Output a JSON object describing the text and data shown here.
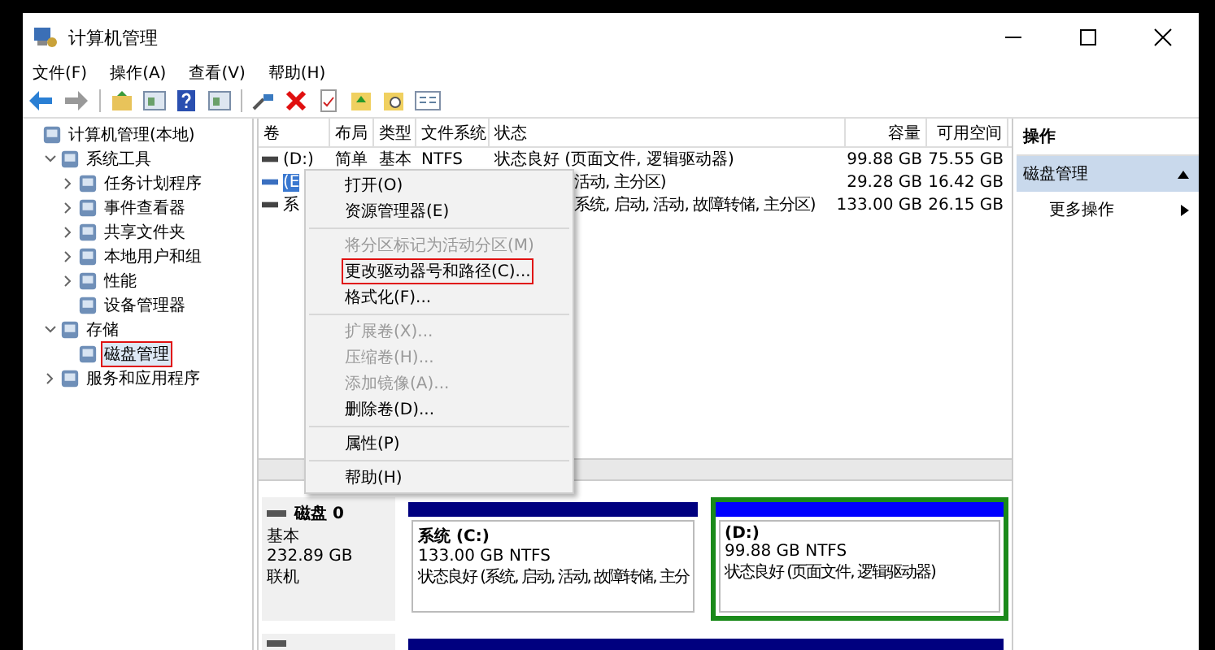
{
  "window": {
    "title": "计算机管理"
  },
  "menu": [
    "文件(F)",
    "操作(A)",
    "查看(V)",
    "帮助(H)"
  ],
  "tree": [
    {
      "label": "计算机管理(本地)",
      "expandable": false,
      "selected": false,
      "highlighted": false,
      "children": [
        {
          "label": "系统工具",
          "expandable": true,
          "expanded": true,
          "selected": false,
          "highlighted": false,
          "children": [
            {
              "label": "任务计划程序",
              "expandable": true,
              "expanded": false,
              "selected": false,
              "highlighted": false
            },
            {
              "label": "事件查看器",
              "expandable": true,
              "expanded": false,
              "selected": false,
              "highlighted": false
            },
            {
              "label": "共享文件夹",
              "expandable": true,
              "expanded": false,
              "selected": false,
              "highlighted": false
            },
            {
              "label": "本地用户和组",
              "expandable": true,
              "expanded": false,
              "selected": false,
              "highlighted": false
            },
            {
              "label": "性能",
              "expandable": true,
              "expanded": false,
              "selected": false,
              "highlighted": false
            },
            {
              "label": "设备管理器",
              "expandable": false,
              "expanded": false,
              "selected": false,
              "highlighted": false
            }
          ]
        },
        {
          "label": "存储",
          "expandable": true,
          "expanded": true,
          "selected": false,
          "highlighted": false,
          "children": [
            {
              "label": "磁盘管理",
              "expandable": false,
              "expanded": false,
              "selected": true,
              "highlighted": true
            }
          ]
        },
        {
          "label": "服务和应用程序",
          "expandable": true,
          "expanded": false,
          "selected": false,
          "highlighted": false
        }
      ]
    }
  ],
  "table": {
    "columns": [
      "卷",
      "布局",
      "类型",
      "文件系统",
      "状态",
      "容量",
      "可用空间"
    ],
    "rows": [
      {
        "volume": "(D:)",
        "layout": "简单",
        "type": "基本",
        "fs": "NTFS",
        "status": "状态良好 (页面文件, 逻辑驱动器)",
        "capacity": "99.88 GB",
        "free": "75.55 GB",
        "selected": false
      },
      {
        "volume": "(E",
        "status": "活动, 主分区)",
        "capacity": "29.28 GB",
        "free": "16.42 GB",
        "selected": true
      },
      {
        "volume": "系",
        "status": "系统, 启动, 活动, 故障转储, 主分区)",
        "capacity": "133.00 GB",
        "free": "26.15 GB",
        "selected": false
      }
    ]
  },
  "context_menu": [
    {
      "kind": "item",
      "label": "打开(O)",
      "disabled": false,
      "highlighted": false
    },
    {
      "kind": "item",
      "label": "资源管理器(E)",
      "disabled": false,
      "highlighted": false
    },
    {
      "kind": "separator"
    },
    {
      "kind": "item",
      "label": "将分区标记为活动分区(M)",
      "disabled": true,
      "highlighted": false
    },
    {
      "kind": "item",
      "label": "更改驱动器号和路径(C)...",
      "disabled": false,
      "highlighted": true
    },
    {
      "kind": "item",
      "label": "格式化(F)...",
      "disabled": false,
      "highlighted": false
    },
    {
      "kind": "separator"
    },
    {
      "kind": "item",
      "label": "扩展卷(X)...",
      "disabled": true,
      "highlighted": false
    },
    {
      "kind": "item",
      "label": "压缩卷(H)...",
      "disabled": true,
      "highlighted": false
    },
    {
      "kind": "item",
      "label": "添加镜像(A)...",
      "disabled": true,
      "highlighted": false
    },
    {
      "kind": "item",
      "label": "删除卷(D)...",
      "disabled": false,
      "highlighted": false
    },
    {
      "kind": "separator"
    },
    {
      "kind": "item",
      "label": "属性(P)",
      "disabled": false,
      "highlighted": false
    },
    {
      "kind": "separator"
    },
    {
      "kind": "item",
      "label": "帮助(H)",
      "disabled": false,
      "highlighted": false
    }
  ],
  "disks": [
    {
      "name": "磁盘 0",
      "type": "基本",
      "size": "232.89 GB",
      "state": "联机",
      "partitions": [
        {
          "kind": "primary",
          "selected": false,
          "name": "系统 (C:)",
          "size": "133.00 GB NTFS",
          "status": "状态良好 (系统, 启动, 活动, 故障转储, 主分"
        },
        {
          "kind": "logical",
          "selected": true,
          "name": "(D:)",
          "size": "99.88 GB NTFS",
          "status": "状态良好 (页面文件, 逻辑驱动器)"
        }
      ]
    },
    {
      "partitions": [
        {
          "kind": "primary",
          "selected": false
        }
      ]
    }
  ],
  "actions": {
    "title": "操作",
    "section": "磁盘管理",
    "section_expanded": true,
    "items": [
      {
        "label": "更多操作"
      }
    ]
  }
}
